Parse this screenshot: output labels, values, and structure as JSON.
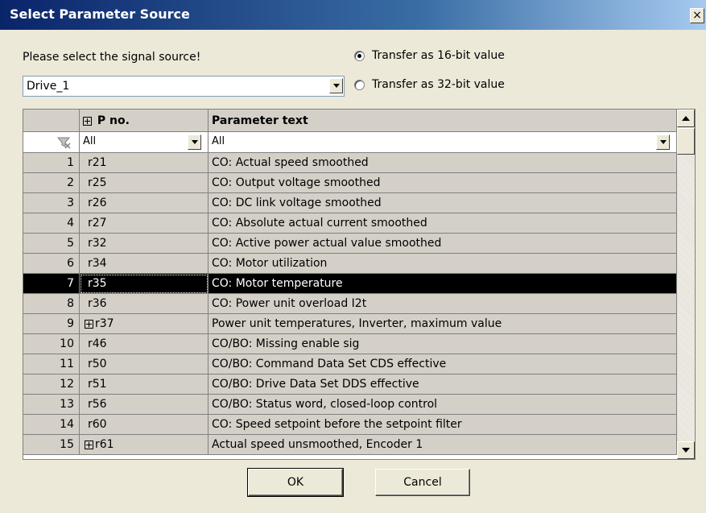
{
  "window": {
    "title": "Select Parameter Source",
    "close_label": "×"
  },
  "prompt": "Please select the signal source!",
  "radios": [
    {
      "label": "Transfer as 16-bit value",
      "checked": true
    },
    {
      "label": "Transfer as 32-bit value",
      "checked": false
    }
  ],
  "source": {
    "value": "Drive_1"
  },
  "grid": {
    "headers": {
      "pno": "P no.",
      "text": "Parameter text"
    },
    "filter": {
      "pno": "All",
      "text": "All"
    },
    "selected_index": 7,
    "rows": [
      {
        "idx": "1",
        "pno": "r21",
        "text": "CO: Actual speed smoothed",
        "expandable": false
      },
      {
        "idx": "2",
        "pno": "r25",
        "text": "CO: Output voltage smoothed",
        "expandable": false
      },
      {
        "idx": "3",
        "pno": "r26",
        "text": "CO: DC link voltage smoothed",
        "expandable": false
      },
      {
        "idx": "4",
        "pno": "r27",
        "text": "CO: Absolute actual current smoothed",
        "expandable": false
      },
      {
        "idx": "5",
        "pno": "r32",
        "text": "CO: Active power actual value smoothed",
        "expandable": false
      },
      {
        "idx": "6",
        "pno": "r34",
        "text": "CO: Motor utilization",
        "expandable": false
      },
      {
        "idx": "7",
        "pno": "r35",
        "text": "CO: Motor temperature",
        "expandable": false
      },
      {
        "idx": "8",
        "pno": "r36",
        "text": "CO: Power unit overload I2t",
        "expandable": false
      },
      {
        "idx": "9",
        "pno": "r37",
        "text": "Power unit temperatures, Inverter, maximum value",
        "expandable": true
      },
      {
        "idx": "10",
        "pno": "r46",
        "text": "CO/BO: Missing enable sig",
        "expandable": false
      },
      {
        "idx": "11",
        "pno": "r50",
        "text": "CO/BO: Command Data Set CDS effective",
        "expandable": false
      },
      {
        "idx": "12",
        "pno": "r51",
        "text": "CO/BO: Drive Data Set DDS effective",
        "expandable": false
      },
      {
        "idx": "13",
        "pno": "r56",
        "text": "CO/BO: Status word, closed-loop control",
        "expandable": false
      },
      {
        "idx": "14",
        "pno": "r60",
        "text": "CO: Speed setpoint before the setpoint filter",
        "expandable": false
      },
      {
        "idx": "15",
        "pno": "r61",
        "text": "Actual speed unsmoothed, Encoder 1",
        "expandable": true
      }
    ]
  },
  "buttons": {
    "ok": "OK",
    "cancel": "Cancel"
  }
}
